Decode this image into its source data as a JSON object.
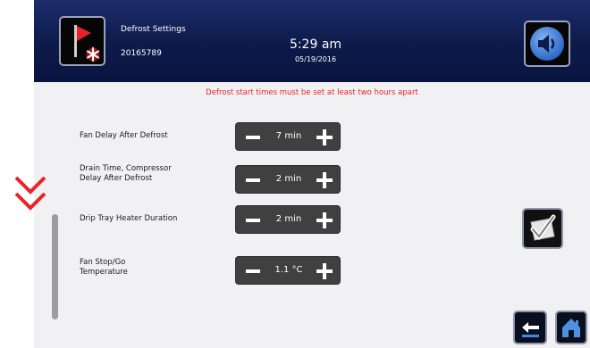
{
  "header": {
    "title": "Defrost Settings",
    "id": "20165789",
    "time": "5:29 am",
    "date": "05/19/2016"
  },
  "warning": "Defrost start times must be set at least two hours apart",
  "settings": [
    {
      "label_lines": [
        "Fan Delay After Defrost"
      ],
      "value": "7 min"
    },
    {
      "label_lines": [
        "Drain Time, Compressor",
        "Delay After Defrost"
      ],
      "value": "2 min"
    },
    {
      "label_lines": [
        "Drip Tray Heater Duration"
      ],
      "value": "2 min"
    },
    {
      "label_lines": [
        "Fan Stop/Go",
        "Temperature"
      ],
      "value": "1.1 °C"
    }
  ],
  "icons": {
    "flag": "defrost-flag-icon",
    "sound": "speaker-icon",
    "check": "checkmark-icon",
    "back": "back-arrow-icon",
    "home": "home-icon",
    "scroll_hint": "double-chevron-down-icon"
  },
  "colors": {
    "header": "#0d1a4a",
    "warning": "#e8242a",
    "stepper": "#404040",
    "hint": "#e8242a"
  }
}
